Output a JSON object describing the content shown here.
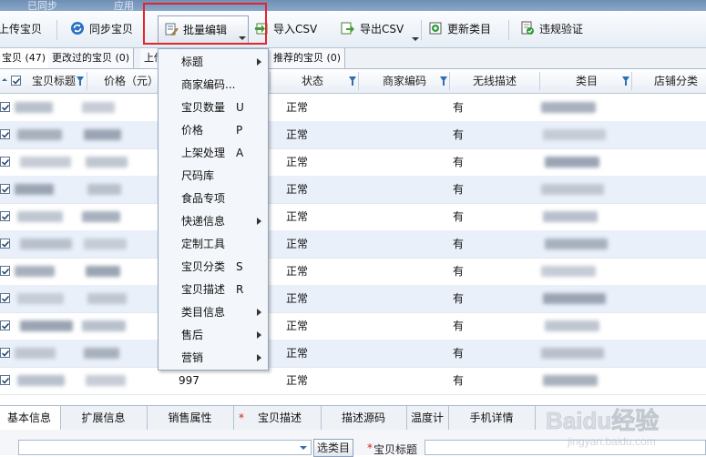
{
  "top_strip": {
    "left": "已同步",
    "right": "应用"
  },
  "toolbar": {
    "items": [
      {
        "label": "上传宝贝",
        "icon": "upload-icon"
      },
      {
        "label": "同步宝贝",
        "icon": "sync-icon"
      },
      {
        "label": "批量编辑",
        "icon": "batch-edit-icon"
      },
      {
        "label": "导入CSV",
        "icon": "import-csv-icon"
      },
      {
        "label": "导出CSV",
        "icon": "export-csv-icon"
      },
      {
        "label": "更新类目",
        "icon": "update-category-icon"
      },
      {
        "label": "违规验证",
        "icon": "violation-check-icon"
      }
    ]
  },
  "tabs": [
    "宝贝 (47)",
    "更改过的宝贝 (0)",
    "上传",
    "推荐的宝贝 (0)"
  ],
  "grid": {
    "columns": [
      "宝贝标题",
      "价格（元）",
      "状态",
      "商家编码",
      "无线描述",
      "类目",
      "店铺分类"
    ],
    "rows": [
      {
        "status": "正常",
        "wireless": "有",
        "price": ""
      },
      {
        "status": "正常",
        "wireless": "有",
        "price": ""
      },
      {
        "status": "正常",
        "wireless": "有",
        "price": ""
      },
      {
        "status": "正常",
        "wireless": "有",
        "price": ""
      },
      {
        "status": "正常",
        "wireless": "有",
        "price": ""
      },
      {
        "status": "正常",
        "wireless": "有",
        "price": ""
      },
      {
        "status": "正常",
        "wireless": "有",
        "price": ""
      },
      {
        "status": "正常",
        "wireless": "有",
        "price": ""
      },
      {
        "status": "正常",
        "wireless": "有",
        "price": ""
      },
      {
        "status": "正常",
        "wireless": "有",
        "price": ""
      },
      {
        "status": "正常",
        "wireless": "有",
        "price": "997"
      }
    ]
  },
  "menu": {
    "items": [
      {
        "label": "标题",
        "key": "",
        "submenu": true
      },
      {
        "label": "商家编码...",
        "key": "",
        "submenu": false
      },
      {
        "label": "宝贝数量",
        "key": "U",
        "submenu": false
      },
      {
        "label": "价格",
        "key": "P",
        "submenu": false
      },
      {
        "label": "上架处理",
        "key": "A",
        "submenu": false
      },
      {
        "label": "尺码库",
        "key": "",
        "submenu": false
      },
      {
        "label": "食品专项",
        "key": "",
        "submenu": false
      },
      {
        "label": "快递信息",
        "key": "",
        "submenu": true
      },
      {
        "label": "定制工具",
        "key": "",
        "submenu": false
      },
      {
        "label": "宝贝分类",
        "key": "S",
        "submenu": false
      },
      {
        "label": "宝贝描述",
        "key": "R",
        "submenu": false
      },
      {
        "label": "类目信息",
        "key": "",
        "submenu": true
      },
      {
        "label": "售后",
        "key": "",
        "submenu": true
      },
      {
        "label": "营销",
        "key": "",
        "submenu": true
      }
    ]
  },
  "bottom_tabs": [
    "基本信息",
    "扩展信息",
    "销售属性",
    "*",
    "宝贝描述",
    "描述源码",
    "温度计",
    "手机详情"
  ],
  "bottom_bar": {
    "select_button": "选类目",
    "required_mark": "*",
    "title_label": "宝贝标题"
  },
  "watermark": {
    "brand": "Baidu经验",
    "url": "jingyan.baidu.com"
  },
  "colors": {
    "highlight": "#e2262b",
    "row_alt": "#e9f0fa",
    "header_bg": "#e9eef5"
  }
}
